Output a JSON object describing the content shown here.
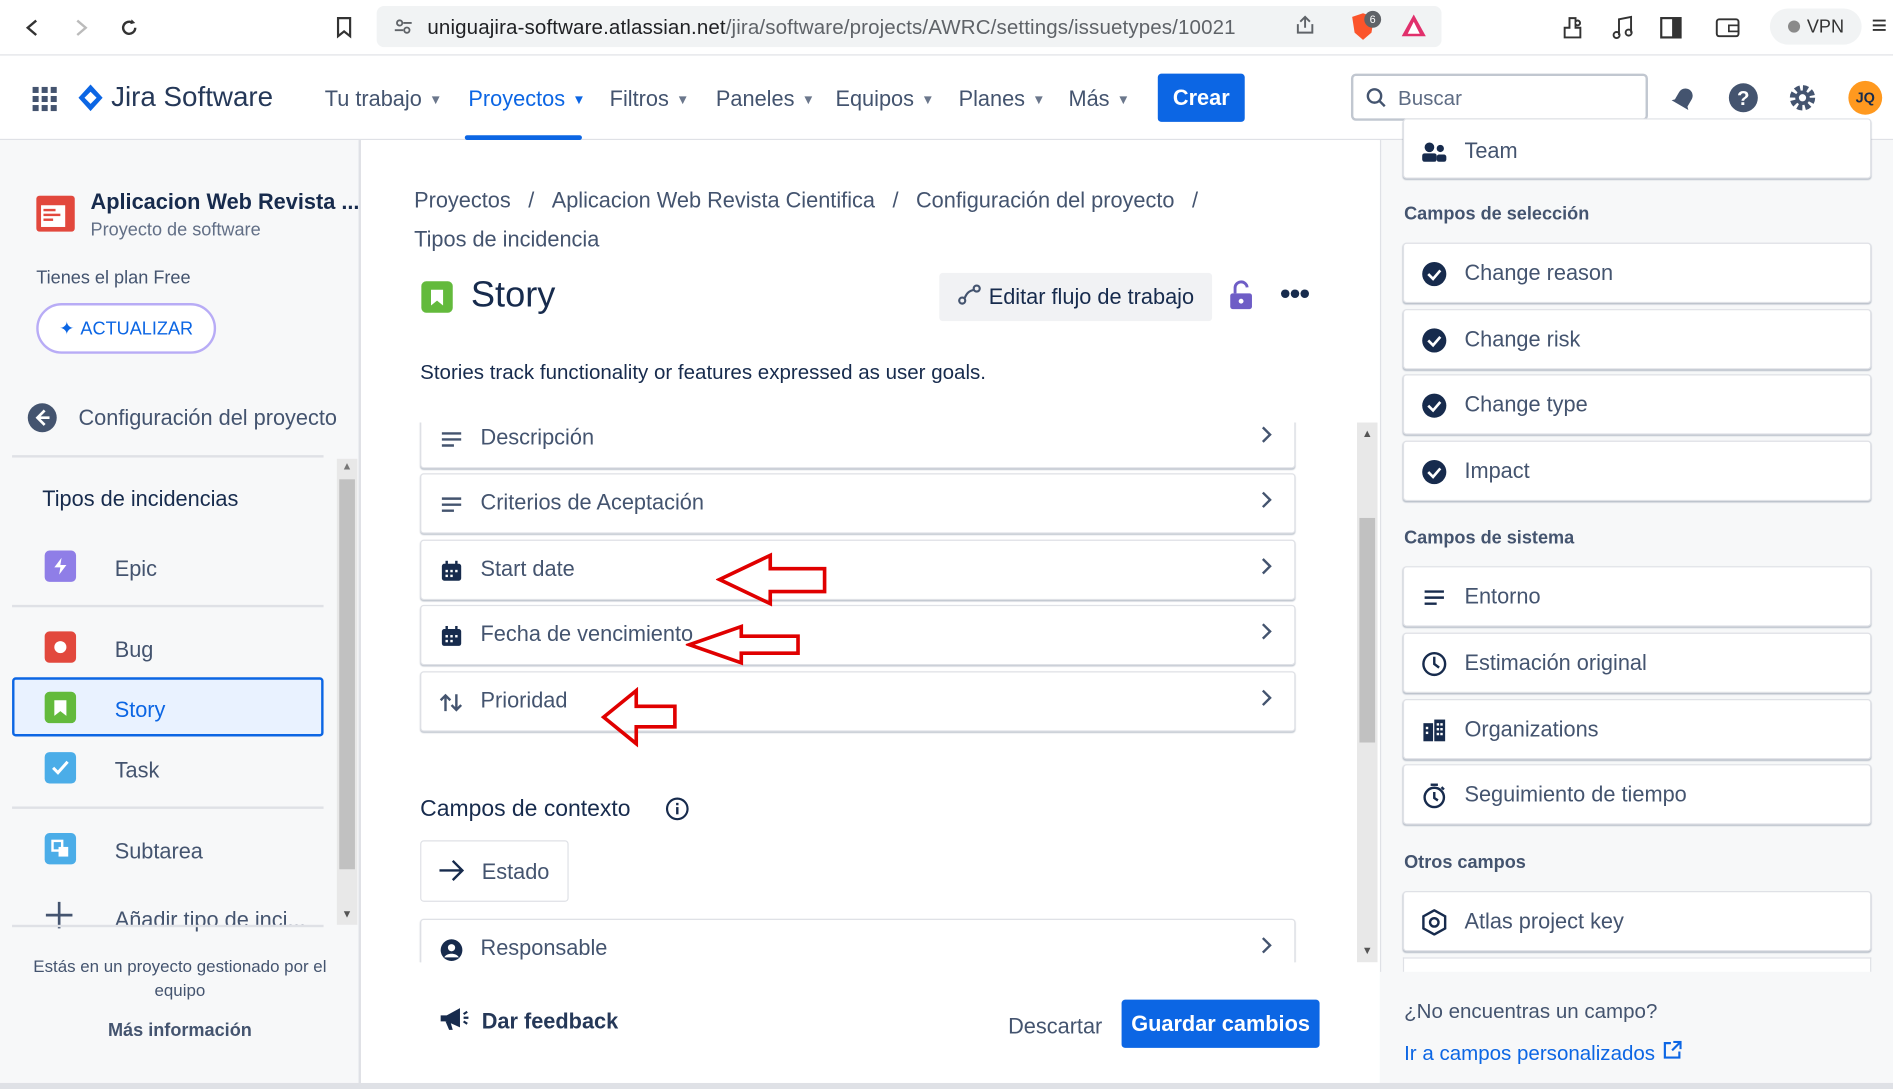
{
  "browser": {
    "url_host": "uniguajira-software.atlassian.net",
    "url_path": "/jira/software/projects/AWRC/settings/issuetypes/10021",
    "brave_badge": "6",
    "vpn_label": "VPN"
  },
  "topnav": {
    "logo_text": "Jira Software",
    "items": [
      "Tu trabajo",
      "Proyectos",
      "Filtros",
      "Paneles",
      "Equipos",
      "Planes",
      "Más"
    ],
    "create_label": "Crear",
    "search_placeholder": "Buscar",
    "avatar_initials": "JQ"
  },
  "sidebar": {
    "project_name": "Aplicacion Web Revista ...",
    "project_type": "Proyecto de software",
    "plan_text": "Tienes el plan Free",
    "upgrade_label": "ACTUALIZAR",
    "back_label": "Configuración del proyecto",
    "section_title": "Tipos de incidencias",
    "issue_types": [
      {
        "label": "Epic",
        "color": "#8f7ee7"
      },
      {
        "label": "Bug",
        "color": "#e2483d"
      },
      {
        "label": "Story",
        "color": "#63ba3c"
      },
      {
        "label": "Task",
        "color": "#4bade8"
      },
      {
        "label": "Subtarea",
        "color": "#4bade8"
      },
      {
        "label": "Añadir tipo de inci..."
      }
    ],
    "footer_text": "Estás en un proyecto gestionado por el equipo",
    "more_info": "Más información"
  },
  "main": {
    "breadcrumb": [
      "Proyectos",
      "Aplicacion Web Revista Cientifica",
      "Configuración del proyecto",
      "Tipos de incidencia"
    ],
    "breadcrumb_sep": "/",
    "title": "Story",
    "edit_workflow_label": "Editar flujo de trabajo",
    "description": "Stories track functionality or features expressed as user goals.",
    "fields": [
      "Descripción",
      "Criterios de Aceptación",
      "Start date",
      "Fecha de vencimiento",
      "Prioridad"
    ],
    "context_title": "Campos de contexto",
    "context_fields": [
      "Estado",
      "Responsable"
    ],
    "feedback_label": "Dar feedback",
    "discard_label": "Descartar",
    "save_label": "Guardar cambios"
  },
  "rightpanel": {
    "top_field": "Team",
    "groups": [
      {
        "title": "Campos de selección",
        "fields": [
          "Change reason",
          "Change risk",
          "Change type",
          "Impact"
        ]
      },
      {
        "title": "Campos de sistema",
        "fields": [
          "Entorno",
          "Estimación original",
          "Organizations",
          "Seguimiento de tiempo"
        ]
      },
      {
        "title": "Otros campos",
        "fields": [
          "Atlas project key"
        ]
      }
    ],
    "not_found": "¿No encuentras un campo?",
    "custom_fields_link": "Ir a campos personalizados"
  },
  "colors": {
    "accent": "#0c66e4",
    "annotation_arrow": "#e00000",
    "selected_border": "#0c66e4"
  }
}
